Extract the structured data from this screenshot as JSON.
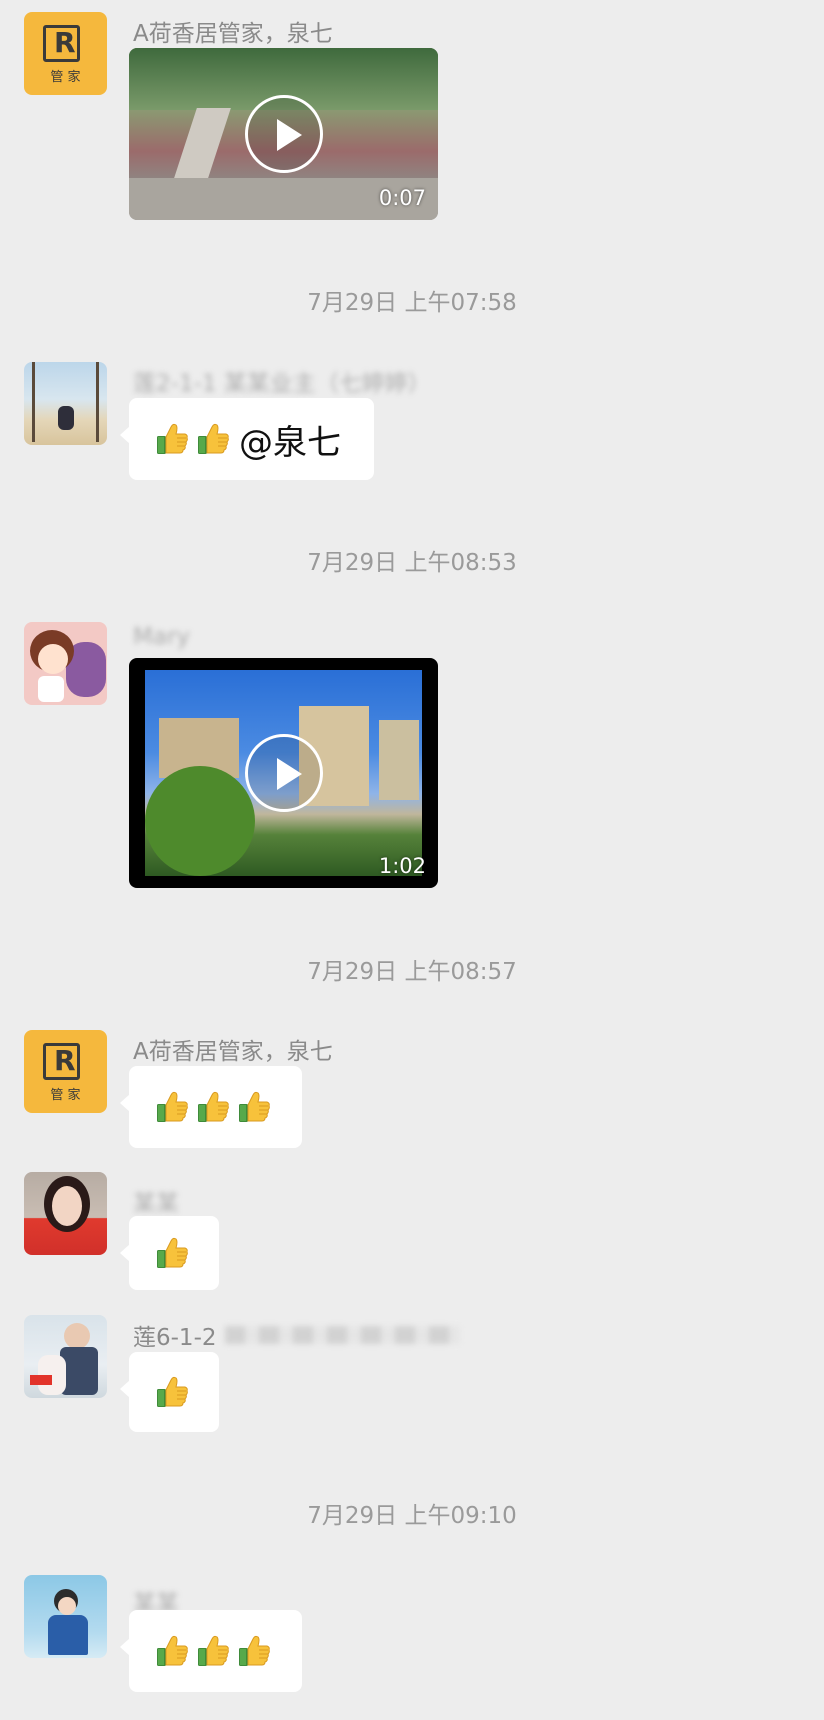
{
  "messages": [
    {
      "sender": "A荷香居管家，泉七",
      "video_duration": "0:07"
    },
    {
      "timestamp": "7月29日 上午07:58"
    },
    {
      "sender": "莲2-1-1 某某业主（七婷婷）",
      "text": "@泉七"
    },
    {
      "timestamp": "7月29日 上午08:53"
    },
    {
      "sender": "Mary",
      "video_duration": "1:02"
    },
    {
      "timestamp": "7月29日 上午08:57"
    },
    {
      "sender": "A荷香居管家，泉七"
    },
    {
      "sender": "某某"
    },
    {
      "sender": "莲6-1-2"
    },
    {
      "timestamp": "7月29日 上午09:10"
    },
    {
      "sender": "某某"
    }
  ],
  "logo_text": {
    "main": "R",
    "sub": "管 家"
  },
  "icons": {
    "thumbs_up": "thumbs-up-icon",
    "play": "play-icon"
  },
  "colors": {
    "background": "#ededed",
    "bubble": "#ffffff",
    "logo_avatar": "#f5b83d"
  }
}
